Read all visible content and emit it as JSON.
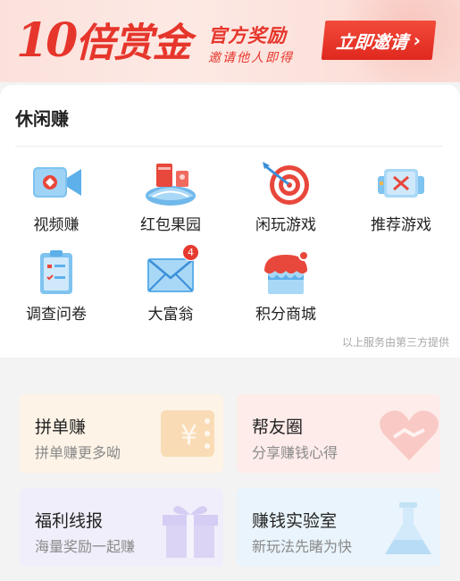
{
  "banner": {
    "headline_num": "10",
    "headline_text": "倍赏金",
    "line1": "官方奖励",
    "line2": "邀请他人即得",
    "button": "立即邀请",
    "chevron": "›"
  },
  "section": {
    "title": "休闲赚",
    "items": [
      {
        "label": "视频赚",
        "icon": "video-camera-icon"
      },
      {
        "label": "红包果园",
        "icon": "red-envelope-orchard-icon"
      },
      {
        "label": "闲玩游戏",
        "icon": "target-icon"
      },
      {
        "label": "推荐游戏",
        "icon": "gamepad-icon"
      },
      {
        "label": "调查问卷",
        "icon": "clipboard-icon"
      },
      {
        "label": "大富翁",
        "icon": "envelope-icon",
        "badge": "4"
      },
      {
        "label": "积分商城",
        "icon": "shop-icon"
      }
    ],
    "footnote": "以上服务由第三方提供"
  },
  "tiles": [
    {
      "title": "拼单赚",
      "subtitle": "拼单赚更多呦",
      "bg": "#fdf3e6",
      "icon": "yen-ticket-icon"
    },
    {
      "title": "帮友圈",
      "subtitle": "分享赚钱心得",
      "bg": "#fdecea",
      "icon": "heart-handshake-icon"
    },
    {
      "title": "福利线报",
      "subtitle": "海量奖励一起赚",
      "bg": "#f1eefb",
      "icon": "gift-icon"
    },
    {
      "title": "赚钱实验室",
      "subtitle": "新玩法先睹为快",
      "bg": "#e9f4fc",
      "icon": "flask-icon"
    }
  ],
  "colors": {
    "accent": "#e6362c"
  }
}
